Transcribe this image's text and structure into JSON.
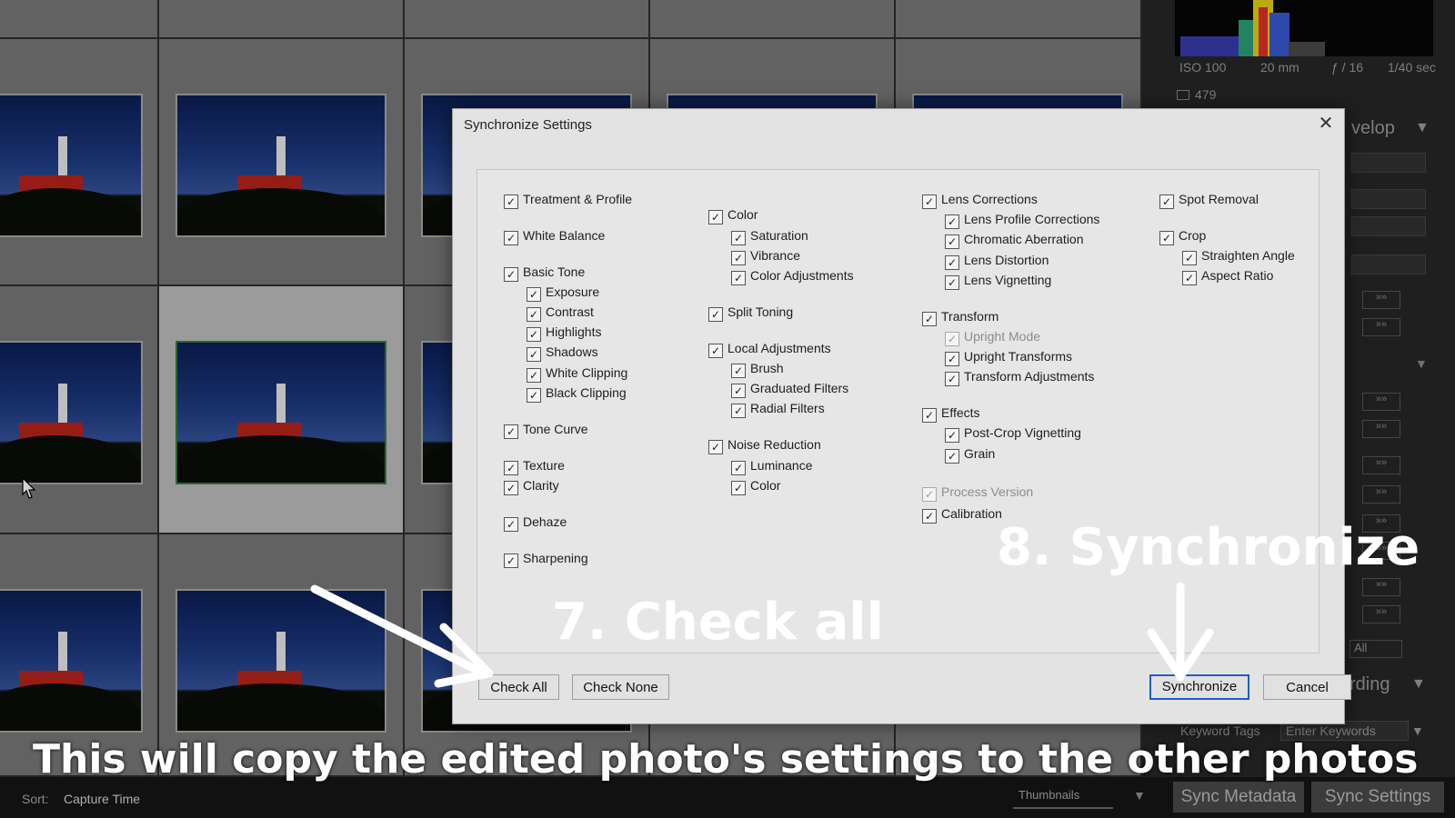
{
  "library": {
    "histogram_meta": {
      "iso": "ISO 100",
      "focal": "20 mm",
      "aperture": "ƒ / 16",
      "shutter": "1/40 sec",
      "count": "479"
    },
    "panel_fragments": {
      "develop": "velop",
      "keywording": "rding",
      "all": "All"
    },
    "keyword_row": {
      "label": "Keyword Tags",
      "value": "Enter Keywords"
    },
    "bottom": {
      "sort_label": "Sort:",
      "sort_value": "Capture Time",
      "thumbnails_label": "Thumbnails",
      "sync_metadata": "Sync Metadata",
      "sync_settings": "Sync Settings"
    }
  },
  "dialog": {
    "title": "Synchronize Settings",
    "columns": {
      "col1": [
        {
          "label": "Treatment & Profile",
          "checked": true
        },
        {
          "label": "White Balance",
          "checked": true
        },
        {
          "label": "Basic Tone",
          "checked": true
        },
        {
          "label": "Exposure",
          "checked": true
        },
        {
          "label": "Contrast",
          "checked": true
        },
        {
          "label": "Highlights",
          "checked": true
        },
        {
          "label": "Shadows",
          "checked": true
        },
        {
          "label": "White Clipping",
          "checked": true
        },
        {
          "label": "Black Clipping",
          "checked": true
        },
        {
          "label": "Tone Curve",
          "checked": true
        },
        {
          "label": "Texture",
          "checked": true
        },
        {
          "label": "Clarity",
          "checked": true
        },
        {
          "label": "Dehaze",
          "checked": true
        },
        {
          "label": "Sharpening",
          "checked": true
        }
      ],
      "col2": [
        {
          "label": "Color",
          "checked": true
        },
        {
          "label": "Saturation",
          "checked": true
        },
        {
          "label": "Vibrance",
          "checked": true
        },
        {
          "label": "Color Adjustments",
          "checked": true
        },
        {
          "label": "Split Toning",
          "checked": true
        },
        {
          "label": "Local Adjustments",
          "checked": true
        },
        {
          "label": "Brush",
          "checked": true
        },
        {
          "label": "Graduated Filters",
          "checked": true
        },
        {
          "label": "Radial Filters",
          "checked": true
        },
        {
          "label": "Noise Reduction",
          "checked": true
        },
        {
          "label": "Luminance",
          "checked": true
        },
        {
          "label": "Color",
          "checked": true
        }
      ],
      "col3": [
        {
          "label": "Lens Corrections",
          "checked": true
        },
        {
          "label": "Lens Profile Corrections",
          "checked": true
        },
        {
          "label": "Chromatic Aberration",
          "checked": true
        },
        {
          "label": "Lens Distortion",
          "checked": true
        },
        {
          "label": "Lens Vignetting",
          "checked": true
        },
        {
          "label": "Transform",
          "checked": true
        },
        {
          "label": "Upright Mode",
          "checked": true,
          "disabled": true
        },
        {
          "label": "Upright Transforms",
          "checked": true
        },
        {
          "label": "Transform Adjustments",
          "checked": true
        },
        {
          "label": "Effects",
          "checked": true
        },
        {
          "label": "Post-Crop Vignetting",
          "checked": true
        },
        {
          "label": "Grain",
          "checked": true
        },
        {
          "label": "Process Version",
          "checked": true,
          "disabled": true
        },
        {
          "label": "Calibration",
          "checked": true
        }
      ],
      "col4": [
        {
          "label": "Spot Removal",
          "checked": true
        },
        {
          "label": "Crop",
          "checked": true
        },
        {
          "label": "Straighten Angle",
          "checked": true
        },
        {
          "label": "Aspect Ratio",
          "checked": true
        }
      ]
    },
    "buttons": {
      "check_all": "Check All",
      "check_none": "Check None",
      "synchronize": "Synchronize",
      "cancel": "Cancel"
    }
  },
  "annotations": {
    "step7": "7. Check all",
    "step8": "8. Synchronize",
    "caption": "This will copy the edited photo's settings to the other photos"
  },
  "colors": {
    "dialog_bg": "#e3e3e3",
    "primary_border": "#1d5fb8",
    "annotation_text": "#ffffff"
  }
}
